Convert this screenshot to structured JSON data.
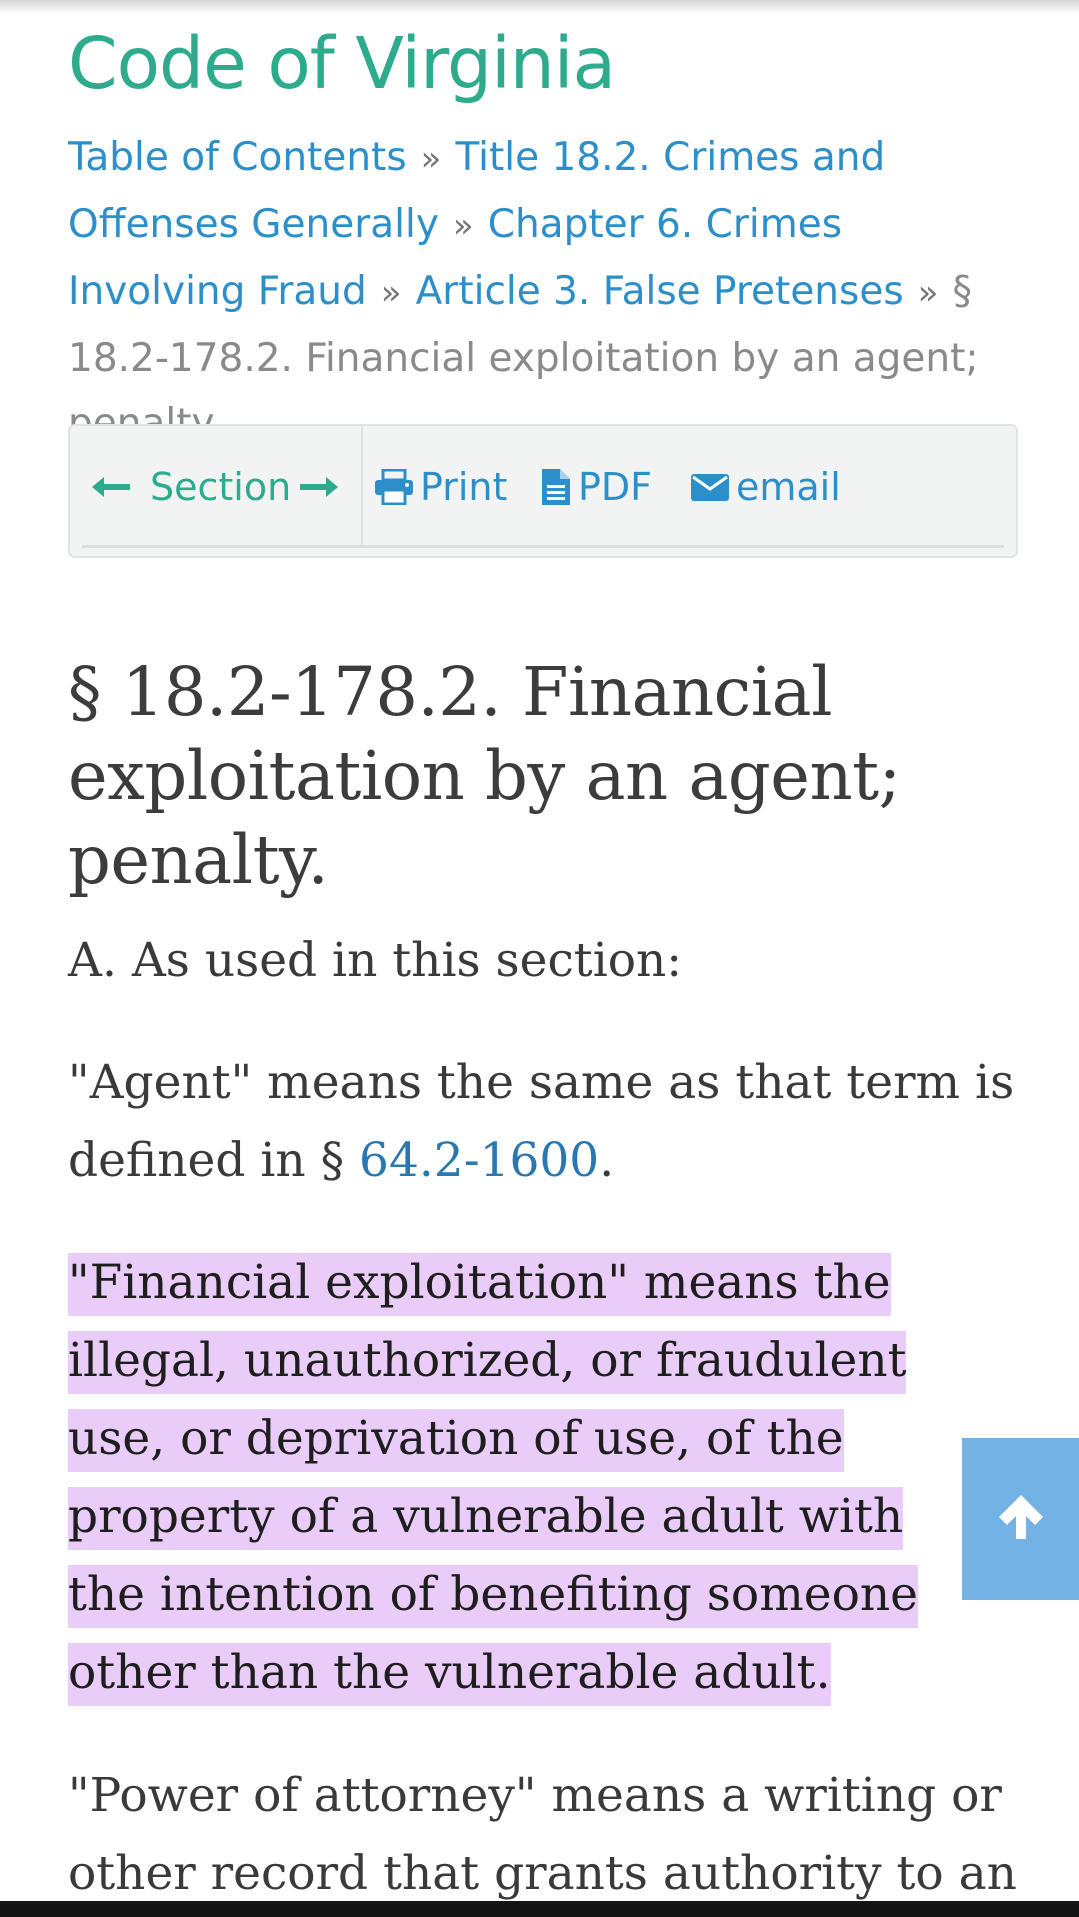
{
  "site": {
    "title": "Code of Virginia"
  },
  "breadcrumb": {
    "items": [
      "Table of Contents",
      "Title 18.2. Crimes and Offenses Generally",
      "Chapter 6. Crimes Involving Fraud",
      "Article 3. False Pretenses"
    ],
    "current": "§ 18.2-178.2. Financial exploitation by an agent; penalty",
    "separator": "»"
  },
  "toolbar": {
    "section_label": "Section",
    "print_label": "Print",
    "pdf_label": "PDF",
    "email_label": "email"
  },
  "section": {
    "title": "§ 18.2-178.2. Financial exploitation by an agent; penalty.",
    "para_a": "A. As used in this section:",
    "agent_def_before": "\"Agent\" means the same as that term is defined in § ",
    "agent_def_link": "64.2-1600",
    "agent_def_after": ".",
    "financial_exploitation_def": "\"Financial exploitation\" means the illegal, unauthorized, or fraudulent use, or deprivation of use, of the property of a vulnerable adult with the intention of benefiting someone other than the vulnerable adult.",
    "power_of_attorney_def": "\"Power of attorney\" means a writing or other record that grants authority to an"
  },
  "colors": {
    "title_green": "#2eaa8c",
    "link_blue": "#2d8fca",
    "highlight": "#e9cdf8",
    "back_to_top": "#67ace2"
  },
  "icons": [
    "arrow-left-icon",
    "arrow-right-icon",
    "print-icon",
    "pdf-file-icon",
    "envelope-icon",
    "arrow-up-icon"
  ]
}
